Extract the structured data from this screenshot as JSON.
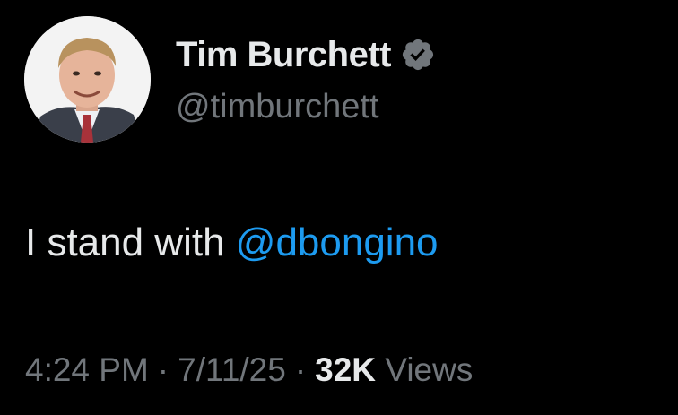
{
  "author": {
    "display_name": "Tim Burchett",
    "handle": "@timburchett",
    "verified": true,
    "verified_icon": "verified-badge-icon",
    "verified_color": "#71767b"
  },
  "tweet": {
    "text_prefix": "I stand with ",
    "mention": "@dbongino",
    "mention_color": "#1d9bf0"
  },
  "meta": {
    "time": "4:24 PM",
    "separator": "·",
    "date": "7/11/25",
    "views_count": "32K",
    "views_label": "Views"
  },
  "colors": {
    "background": "#000000",
    "primary_text": "#e7e9ea",
    "secondary_text": "#71767b"
  }
}
